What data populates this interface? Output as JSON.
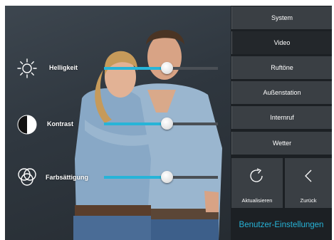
{
  "colors": {
    "accent": "#27b4d8",
    "menu_bg": "#3a3f44",
    "menu_active_bg": "#23272b",
    "track": "#4a4f55"
  },
  "preview": {
    "controls": [
      {
        "label": "Helligkeit",
        "icon": "sun-icon",
        "value": 0.55
      },
      {
        "label": "Kontrast",
        "icon": "contrast-icon",
        "value": 0.55
      },
      {
        "label": "Farbsättigung",
        "icon": "color-saturation-icon",
        "value": 0.55
      }
    ]
  },
  "menu": {
    "items": [
      {
        "label": "System",
        "active": false
      },
      {
        "label": "Video",
        "active": true
      },
      {
        "label": "Ruftöne",
        "active": false
      },
      {
        "label": "Außenstation",
        "active": false
      },
      {
        "label": "Internruf",
        "active": false
      },
      {
        "label": "Wetter",
        "active": false
      }
    ],
    "tiles": [
      {
        "label": "Aktualisieren",
        "icon": "refresh-icon"
      },
      {
        "label": "Zurück",
        "icon": "chevron-left-icon"
      }
    ],
    "footer_title": "Benutzer-Einstellungen"
  }
}
